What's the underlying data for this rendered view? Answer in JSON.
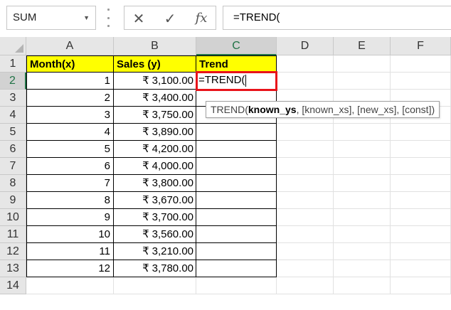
{
  "formula_bar": {
    "name_box": "SUM",
    "cancel_icon": "✕",
    "enter_icon": "✓",
    "fx_icon": "fx",
    "formula": "=TREND("
  },
  "columns": [
    "A",
    "B",
    "C",
    "D",
    "E",
    "F"
  ],
  "selected_column": "C",
  "rows": [
    "1",
    "2",
    "3",
    "4",
    "5",
    "6",
    "7",
    "8",
    "9",
    "10",
    "11",
    "12",
    "13",
    "14"
  ],
  "selected_row": "2",
  "headers": {
    "a": "Month(x)",
    "b": "Sales (y)",
    "c": "Trend"
  },
  "currency_symbol": "₹",
  "data_rows": [
    {
      "month": "1",
      "sales": "3,100.00"
    },
    {
      "month": "2",
      "sales": "3,400.00"
    },
    {
      "month": "3",
      "sales": "3,750.00"
    },
    {
      "month": "4",
      "sales": "3,890.00"
    },
    {
      "month": "5",
      "sales": "4,200.00"
    },
    {
      "month": "6",
      "sales": "4,000.00"
    },
    {
      "month": "7",
      "sales": "3,800.00"
    },
    {
      "month": "8",
      "sales": "3,670.00"
    },
    {
      "month": "9",
      "sales": "3,700.00"
    },
    {
      "month": "10",
      "sales": "3,560.00"
    },
    {
      "month": "11",
      "sales": "3,210.00"
    },
    {
      "month": "12",
      "sales": "3,780.00"
    }
  ],
  "editing_cell": {
    "text": "=TREND("
  },
  "tooltip": {
    "fn": "TREND(",
    "arg_active": "known_ys",
    "rest": ", [known_xs], [new_xs], [const])"
  },
  "colors": {
    "header_fill": "#ffff00",
    "edit_border": "#e8131a",
    "selection_accent": "#217346"
  }
}
